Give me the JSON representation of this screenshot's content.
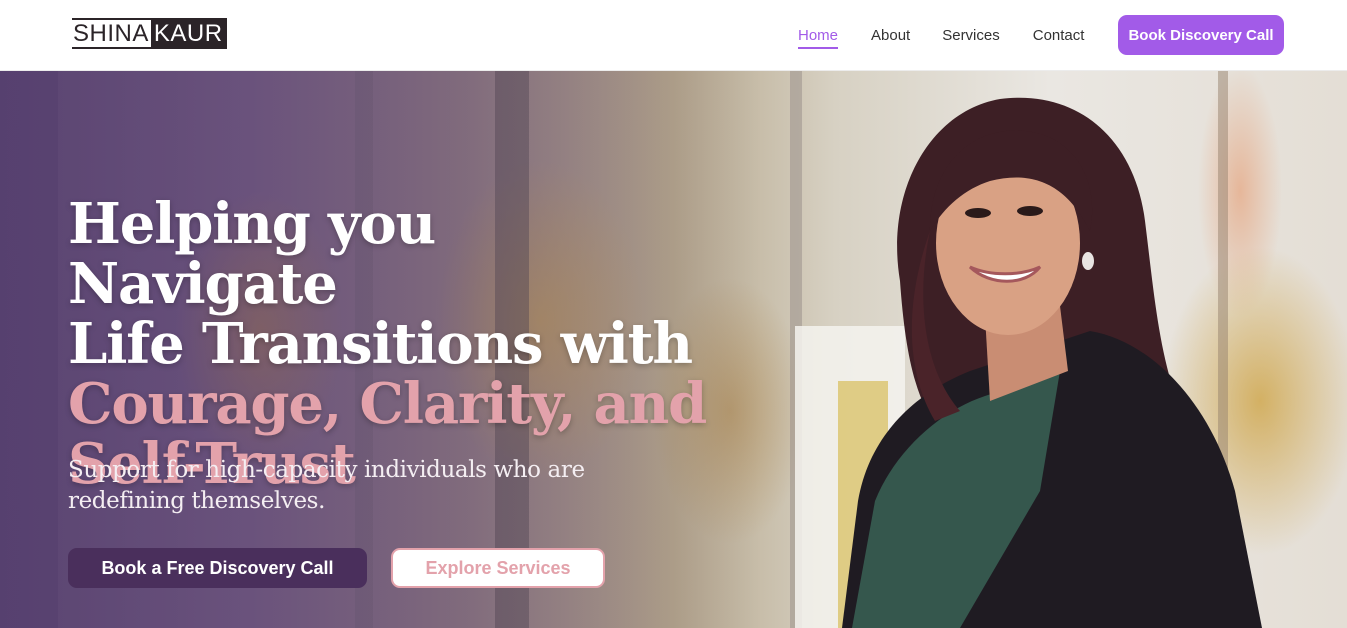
{
  "header": {
    "logo": {
      "first": "SHINA",
      "second": "KAUR"
    },
    "nav": [
      {
        "label": "Home",
        "active": true
      },
      {
        "label": "About",
        "active": false
      },
      {
        "label": "Services",
        "active": false
      },
      {
        "label": "Contact",
        "active": false
      }
    ],
    "cta_label": "Book Discovery Call"
  },
  "hero": {
    "headline_white_1": "Helping you Navigate",
    "headline_white_2": "Life Transitions with",
    "headline_pink_1": "Courage, Clarity, and",
    "headline_pink_2": "Self-Trust",
    "subheading": "Support for high-capacity individuals who are redefining themselves.",
    "primary_cta": "Book a Free Discovery Call",
    "secondary_cta": "Explore Services"
  },
  "colors": {
    "accent_purple": "#a25be8",
    "dark_purple": "#4a2f5c",
    "pink": "#e3a2ab",
    "logo_dark": "#2b2428"
  }
}
